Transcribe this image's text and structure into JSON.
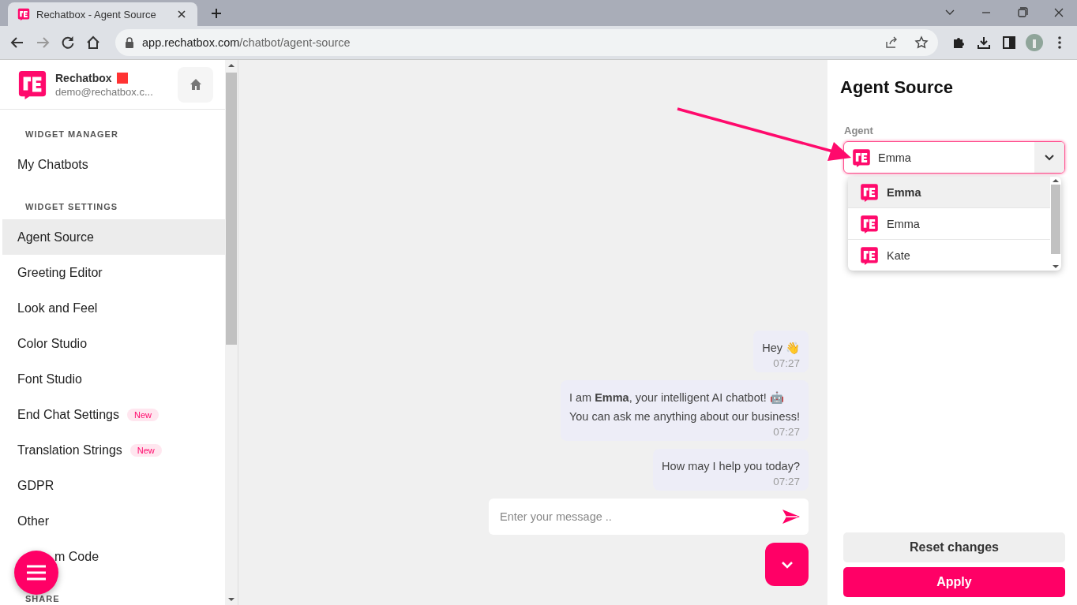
{
  "browser": {
    "tab_title": "Rechatbox - Agent Source",
    "url_host": "app.rechatbox.com",
    "url_path": "/chatbot/agent-source"
  },
  "sidebar": {
    "brand": {
      "name": "Rechatbox",
      "email": "demo@rechatbox.c..."
    },
    "sections": [
      {
        "heading": "WIDGET MANAGER",
        "items": [
          {
            "label": "My Chatbots",
            "selected": false
          }
        ]
      },
      {
        "heading": "WIDGET SETTINGS",
        "items": [
          {
            "label": "Agent Source",
            "selected": true
          },
          {
            "label": "Greeting Editor",
            "selected": false
          },
          {
            "label": "Look and Feel",
            "selected": false
          },
          {
            "label": "Color Studio",
            "selected": false
          },
          {
            "label": "Font Studio",
            "selected": false
          },
          {
            "label": "End Chat Settings",
            "selected": false,
            "badge": "New"
          },
          {
            "label": "Translation Strings",
            "selected": false,
            "badge": "New"
          },
          {
            "label": "GDPR",
            "selected": false
          },
          {
            "label": "Other",
            "selected": false
          },
          {
            "label": "m Code",
            "selected": false,
            "partly_covered": true
          }
        ]
      },
      {
        "heading": "SHARE"
      }
    ]
  },
  "chat": {
    "messages": [
      {
        "lines": [
          "Hey 👋"
        ],
        "time": "07:27"
      },
      {
        "lines": [
          "I am **Emma**, your intelligent AI chatbot! 🤖",
          "You can ask me anything about our business!"
        ],
        "time": "07:27"
      },
      {
        "lines": [
          "How may I help you today?"
        ],
        "time": "07:27"
      }
    ],
    "input": {
      "placeholder": "Enter your message .."
    }
  },
  "panel": {
    "title": "Agent Source",
    "agent_label": "Agent",
    "agent_value": "Emma",
    "options": [
      {
        "name": "Emma",
        "selected": true
      },
      {
        "name": "Emma",
        "selected": false
      },
      {
        "name": "Kate",
        "selected": false
      }
    ],
    "buttons": [
      {
        "label": "Reset changes",
        "kind": "secondary"
      },
      {
        "label": "Apply",
        "kind": "primary"
      }
    ]
  }
}
